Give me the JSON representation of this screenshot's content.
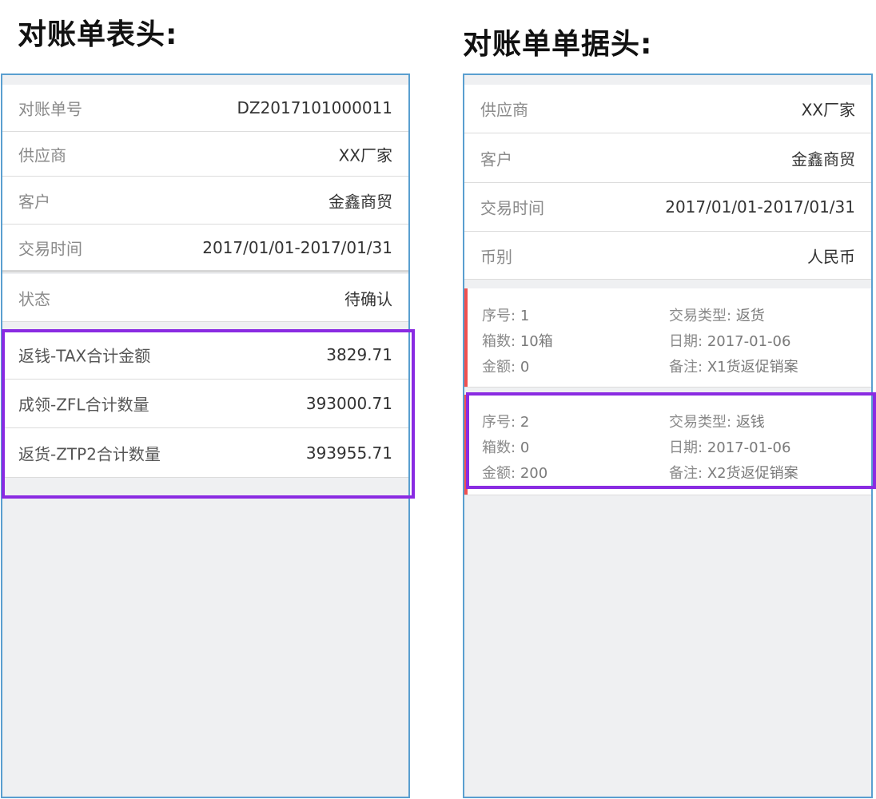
{
  "left": {
    "heading": "对账单表头:",
    "rows": [
      {
        "label": "对账单号",
        "value": "DZ2017101000011"
      },
      {
        "label": "供应商",
        "value": "XX厂家"
      },
      {
        "label": "客户",
        "value": "金鑫商贸"
      },
      {
        "label": "交易时间",
        "value": "2017/01/01-2017/01/31"
      },
      {
        "label": "状态",
        "value": "待确认"
      }
    ],
    "totals": [
      {
        "label": "返钱-TAX合计金额",
        "value": "3829.71"
      },
      {
        "label": "成领-ZFL合计数量",
        "value": "393000.71"
      },
      {
        "label": "返货-ZTP2合计数量",
        "value": "393955.71"
      }
    ]
  },
  "right": {
    "heading": "对账单单据头:",
    "rows": [
      {
        "label": "供应商",
        "value": "XX厂家"
      },
      {
        "label": "客户",
        "value": "金鑫商贸"
      },
      {
        "label": "交易时间",
        "value": "2017/01/01-2017/01/31"
      },
      {
        "label": "币别",
        "value": "人民币"
      }
    ],
    "records": [
      {
        "seq_label": "序号:",
        "seq": "1",
        "type_label": "交易类型:",
        "type": "返货",
        "boxes_label": "箱数:",
        "boxes": "10箱",
        "date_label": "日期:",
        "date": "2017-01-06",
        "amount_label": "金额:",
        "amount": "0",
        "note_label": "备注:",
        "note": "X1货返促销案"
      },
      {
        "seq_label": "序号:",
        "seq": "2",
        "type_label": "交易类型:",
        "type": "返钱",
        "boxes_label": "箱数:",
        "boxes": "0",
        "date_label": "日期:",
        "date": "2017-01-06",
        "amount_label": "金额:",
        "amount": "200",
        "note_label": "备注:",
        "note": "X2货返促销案"
      }
    ]
  },
  "colors": {
    "panel_border": "#5a9fd0",
    "highlight": "#8a2be2",
    "accent": "#f05050",
    "background": "#eff0f2"
  }
}
